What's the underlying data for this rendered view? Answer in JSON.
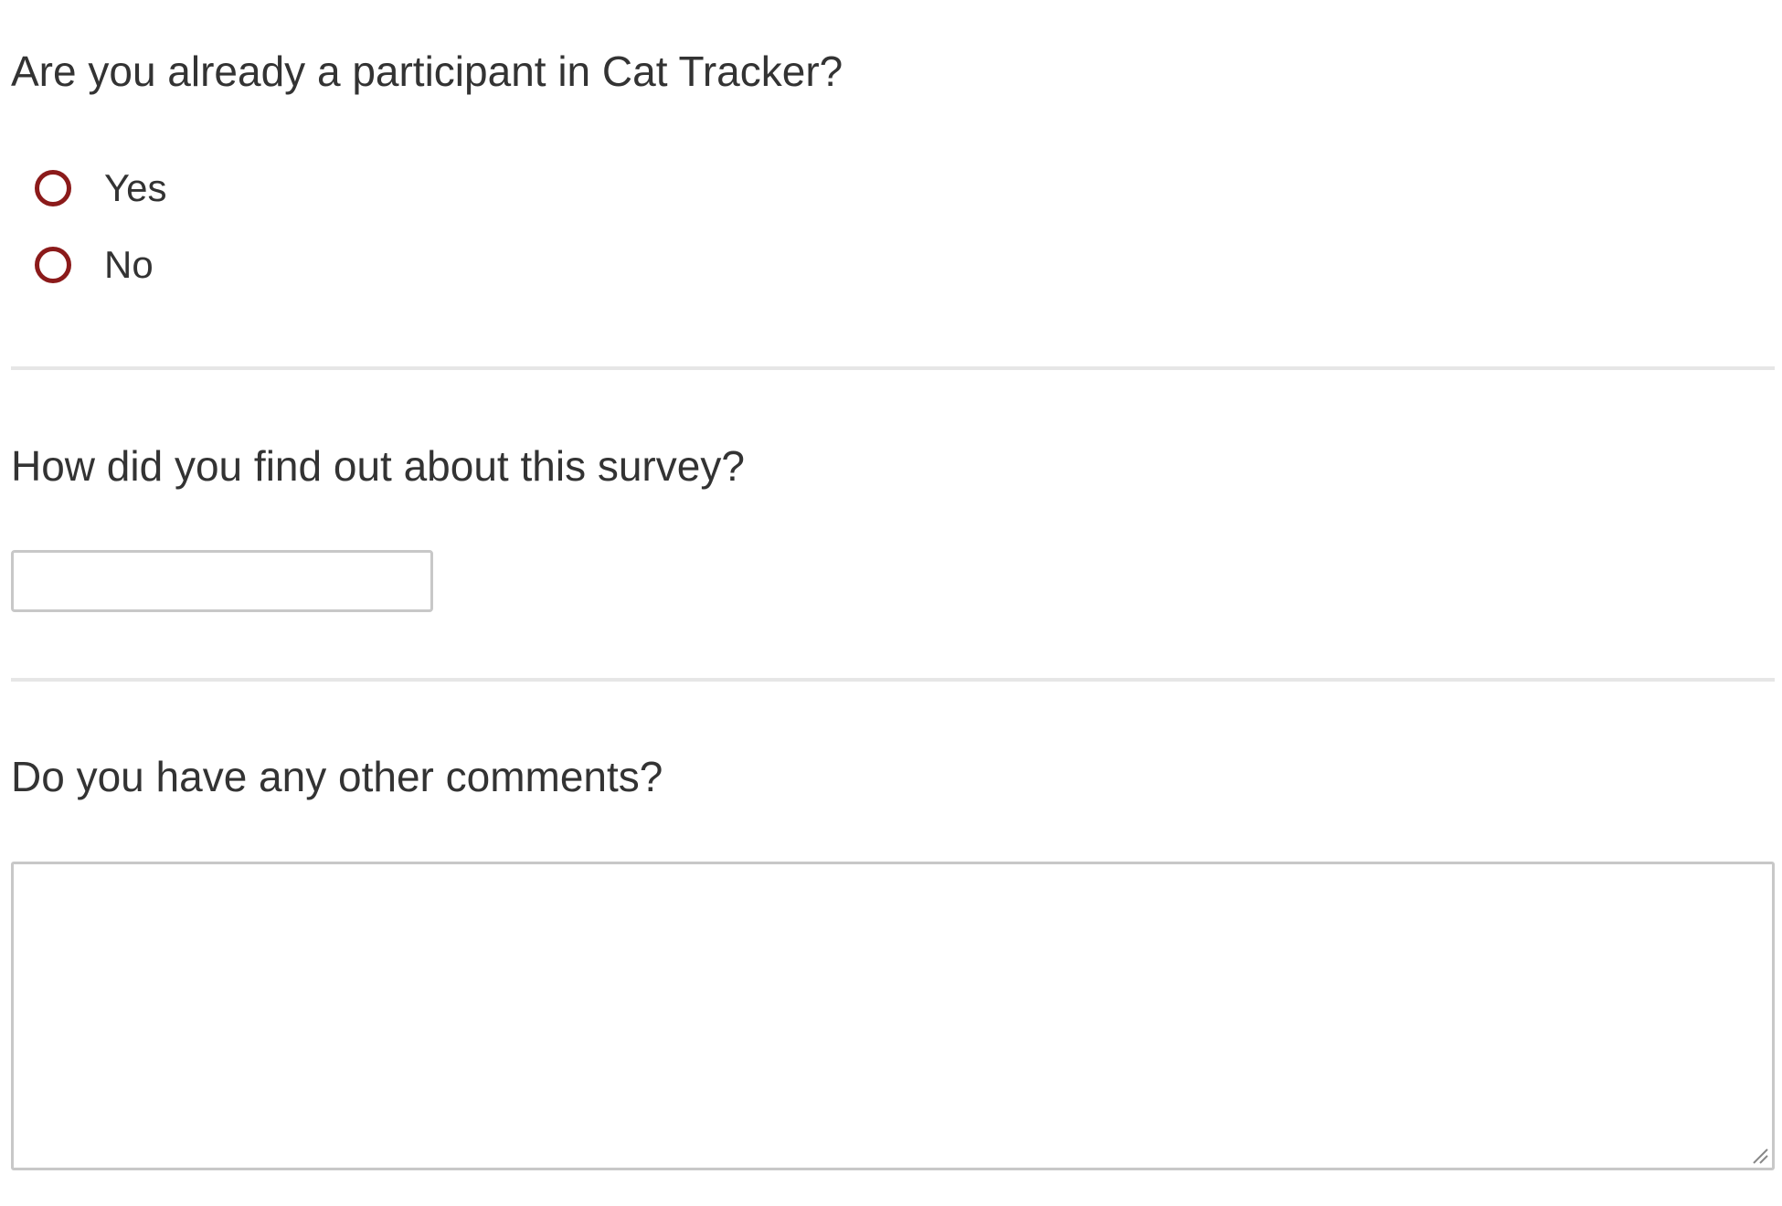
{
  "questions": {
    "participant": {
      "title": "Are you already a participant in Cat Tracker?",
      "options": [
        {
          "label": "Yes",
          "selected": false
        },
        {
          "label": "No",
          "selected": false
        }
      ]
    },
    "source": {
      "title": "How did you find out about this survey?",
      "value": "",
      "placeholder": ""
    },
    "comments": {
      "title": "Do you have any other comments?",
      "value": "",
      "placeholder": ""
    }
  },
  "colors": {
    "radio_border": "#8b1a1a",
    "text": "#333333",
    "input_border": "#c8c8c8",
    "divider": "#e6e6e6"
  },
  "icons": {
    "radio": "radio-unchecked-icon",
    "resize": "resize-handle-icon"
  }
}
